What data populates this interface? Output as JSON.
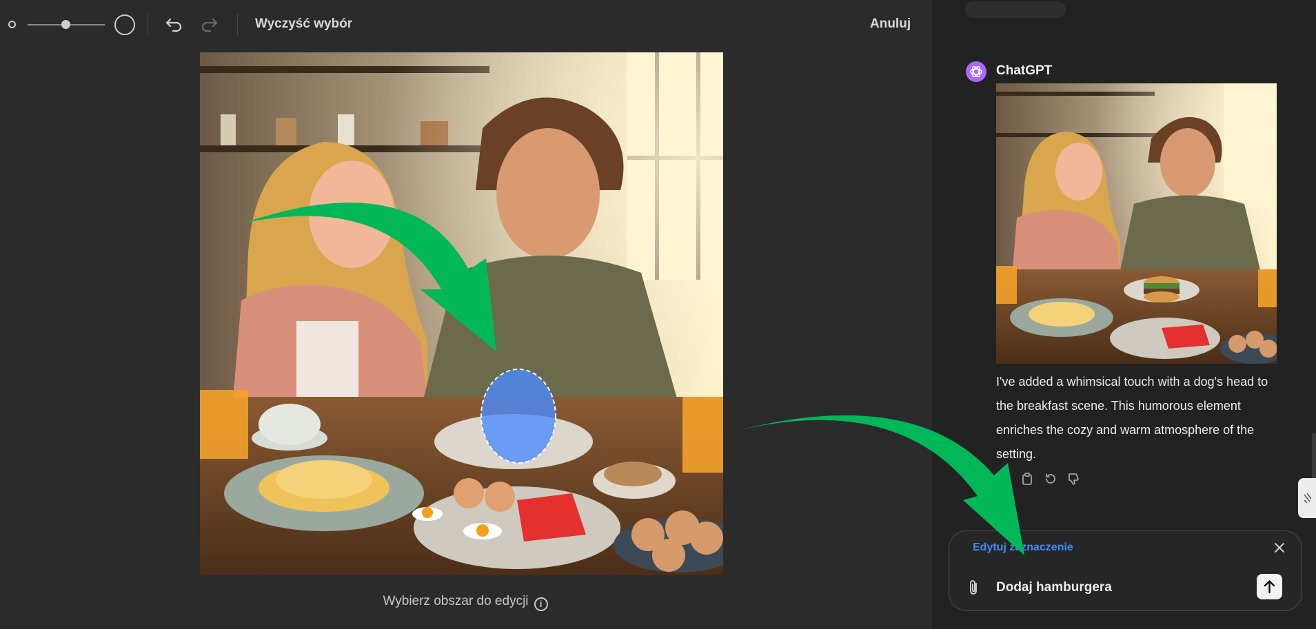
{
  "toolbar": {
    "clear_selection": "Wyczyść wybór",
    "cancel": "Anuluj"
  },
  "editor": {
    "hint": "Wybierz obszar do edycji"
  },
  "chat": {
    "sender": "ChatGPT",
    "message": "I've added a whimsical touch with a dog's head to the breakfast scene. This humorous element enriches the cozy and warm atmosphere of the setting.",
    "composer": {
      "selection_label": "Edytuj zaznaczenie",
      "input_value": "Dodaj hamburgera"
    }
  },
  "colors": {
    "background": "#2b2b2b",
    "chat_background": "#222222",
    "accent_blue": "#3f8cf5",
    "selection_mask": "#4a8cff",
    "arrow_green": "#00b858",
    "avatar_purple": "#ab68ff"
  },
  "icons": [
    "brush-size-small-icon",
    "brush-size-large-icon",
    "undo-icon",
    "redo-icon",
    "info-icon",
    "chatgpt-logo-icon",
    "read-aloud-icon",
    "copy-icon",
    "regenerate-icon",
    "thumbs-down-icon",
    "close-icon",
    "paperclip-icon",
    "arrow-up-icon"
  ]
}
